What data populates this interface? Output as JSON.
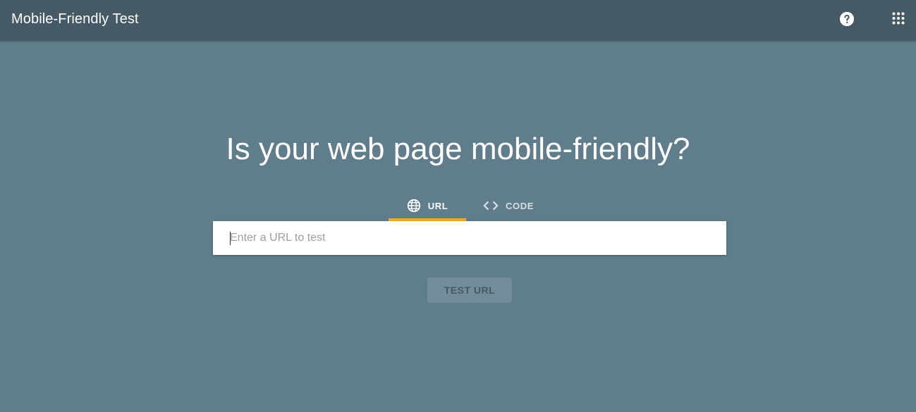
{
  "header": {
    "title": "Mobile-Friendly Test",
    "help_icon": "help-circle-icon",
    "apps_icon": "apps-grid-icon"
  },
  "main": {
    "headline": "Is your web page mobile-friendly?",
    "tabs": [
      {
        "label": "URL",
        "icon": "globe-icon",
        "active": true
      },
      {
        "label": "CODE",
        "icon": "code-brackets-icon",
        "active": false
      }
    ],
    "url_input": {
      "value": "",
      "placeholder": "Enter a URL to test"
    },
    "test_button": {
      "label": "TEST URL",
      "enabled": false
    }
  },
  "colors": {
    "background": "#607d8b",
    "topbar": "#455a64",
    "accent": "#f9a825",
    "text_primary": "#ffffff"
  }
}
